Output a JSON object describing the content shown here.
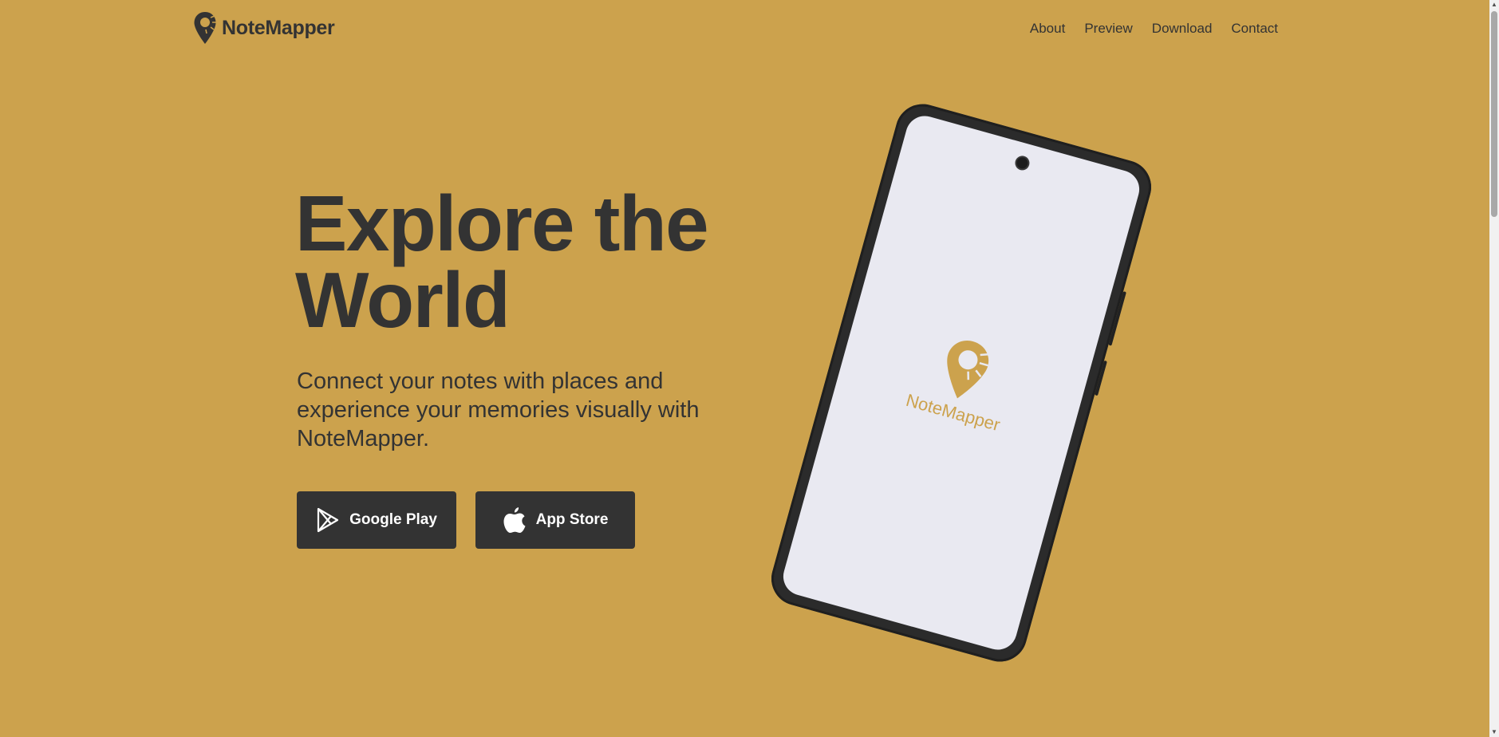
{
  "colors": {
    "background": "#CCA24D",
    "text": "#333333",
    "button_bg": "#333333",
    "button_text": "#ffffff",
    "phone_screen": "#E9E9F1",
    "brand_accent": "#CCA24D"
  },
  "header": {
    "brand": {
      "name": "NoteMapper",
      "icon": "map-pin-logo-icon"
    },
    "nav": [
      {
        "label": "About"
      },
      {
        "label": "Preview"
      },
      {
        "label": "Download"
      },
      {
        "label": "Contact"
      }
    ]
  },
  "hero": {
    "title_line1": "Explore the",
    "title_line2": "World",
    "subtitle": "Connect your notes with places and experience your memories visually with NoteMapper.",
    "buttons": [
      {
        "label": "Google Play",
        "icon": "google-play-icon"
      },
      {
        "label": "App Store",
        "icon": "apple-icon"
      }
    ]
  },
  "phone": {
    "screen_brand": "NoteMapper",
    "screen_icon": "map-pin-logo-icon"
  }
}
